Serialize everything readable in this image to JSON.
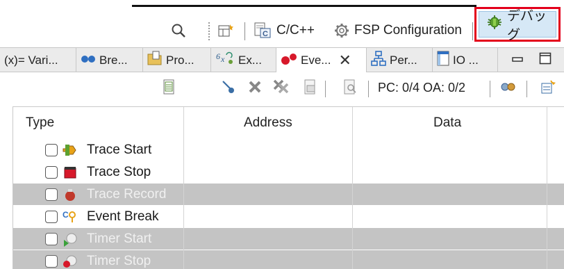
{
  "perspective_toolbar": {
    "search_icon": "search-icon",
    "open_perspective_icon": "open-perspective-icon",
    "perspectives": [
      {
        "label": "C/C++",
        "icon": "cpp-perspective-icon"
      },
      {
        "label": "FSP Configuration",
        "icon": "gear-icon"
      },
      {
        "label": "デバッグ",
        "icon": "bug-icon",
        "highlighted": true
      }
    ],
    "highlight_color": "#e3001b"
  },
  "view_tabs": [
    {
      "label": "(x)= Vari...",
      "icon": "variables-icon"
    },
    {
      "label": "Bre...",
      "icon": "breakpoints-icon"
    },
    {
      "label": "Pro...",
      "icon": "project-icon"
    },
    {
      "label": "Ex...",
      "icon": "expressions-icon"
    },
    {
      "label": "Eve...",
      "icon": "events-icon",
      "active": true
    },
    {
      "label": "Per...",
      "icon": "peripherals-icon"
    },
    {
      "label": "IO ...",
      "icon": "io-icon"
    }
  ],
  "view_toolbar": {
    "status": "PC: 0/4 OA: 0/2"
  },
  "table": {
    "columns": [
      "Type",
      "Address",
      "Data"
    ],
    "rows": [
      {
        "label": "Trace Start",
        "icon": "trace-start-icon",
        "enabled": true
      },
      {
        "label": "Trace Stop",
        "icon": "trace-stop-icon",
        "enabled": true
      },
      {
        "label": "Trace Record",
        "icon": "trace-record-icon",
        "enabled": false
      },
      {
        "label": "Event Break",
        "icon": "event-break-icon",
        "enabled": true
      },
      {
        "label": "Timer Start",
        "icon": "timer-start-icon",
        "enabled": false
      },
      {
        "label": "Timer Stop",
        "icon": "timer-stop-icon",
        "enabled": false
      }
    ]
  }
}
